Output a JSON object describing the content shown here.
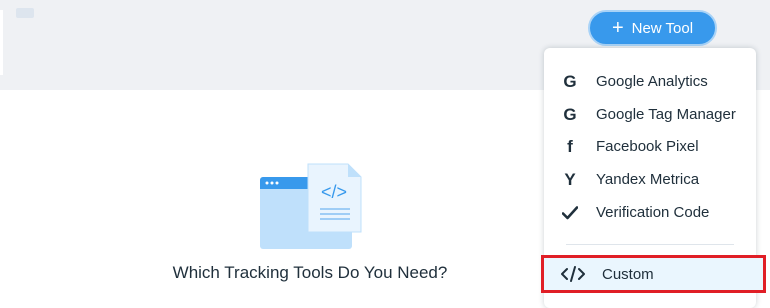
{
  "header": {
    "new_tool_icon": "plus-icon",
    "new_tool_label": "New Tool"
  },
  "empty_state": {
    "title": "Which Tracking Tools Do You Need?",
    "icon": "code-document-icon"
  },
  "dropdown": {
    "items": [
      {
        "label": "Google Analytics",
        "icon": "google-icon",
        "glyph": "G"
      },
      {
        "label": "Google Tag Manager",
        "icon": "google-icon",
        "glyph": "G"
      },
      {
        "label": "Facebook Pixel",
        "icon": "facebook-icon",
        "glyph": "f"
      },
      {
        "label": "Yandex Metrica",
        "icon": "yandex-icon",
        "glyph": "Y"
      },
      {
        "label": "Verification Code",
        "icon": "checkmark-icon",
        "glyph": ""
      }
    ],
    "custom": {
      "label": "Custom",
      "icon": "code-icon"
    }
  },
  "colors": {
    "accent": "#3899ec",
    "highlight_border": "#e01e26",
    "highlight_bg": "#eaf6fe"
  }
}
